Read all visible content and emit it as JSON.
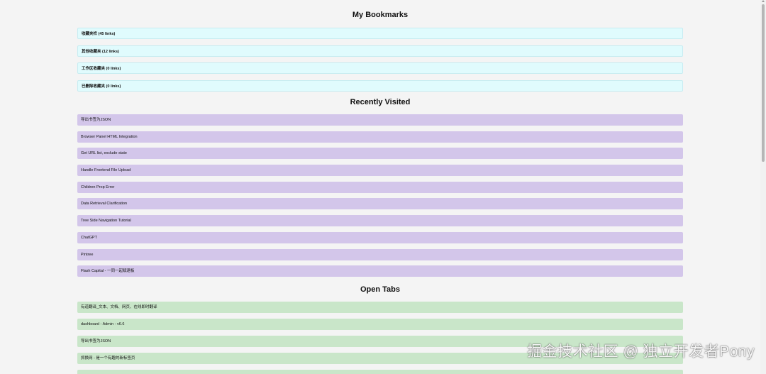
{
  "sections": {
    "bookmarks": {
      "title": "My Bookmarks",
      "folders": [
        "收藏夹栏 (45 links)",
        "其他收藏夹 (12 links)",
        "工作区收藏夹 (0 links)",
        "已删除收藏夹 (0 links)"
      ]
    },
    "recent": {
      "title": "Recently Visited",
      "items": [
        "导出书签为JSON",
        "Browser Panel HTML Integration",
        "Get URL list, exclude state",
        "Handle Frontend File Upload",
        "Children Prop Error",
        "Data Retrieval Clarification",
        "Tree Side Navigation Tutorial",
        "ChatGPT",
        "Pintree",
        "Flash Capital - 一同一起赋速板"
      ]
    },
    "tabs": {
      "title": "Open Tabs",
      "items": [
        "有道翻译_文本、文档、网页、在线即时翻译",
        "dashboard - Admin - v6.6",
        "导出书签为JSON",
        "抓换网 - 是一个有趣的新标签页"
      ]
    }
  },
  "colors": {
    "folder_bg": "#e0fbfd",
    "recent_bg": "#d3c6ea",
    "tab_bg": "#c9e6c9"
  },
  "watermark": "掘金技术社区 @ 独立开发者Pony"
}
